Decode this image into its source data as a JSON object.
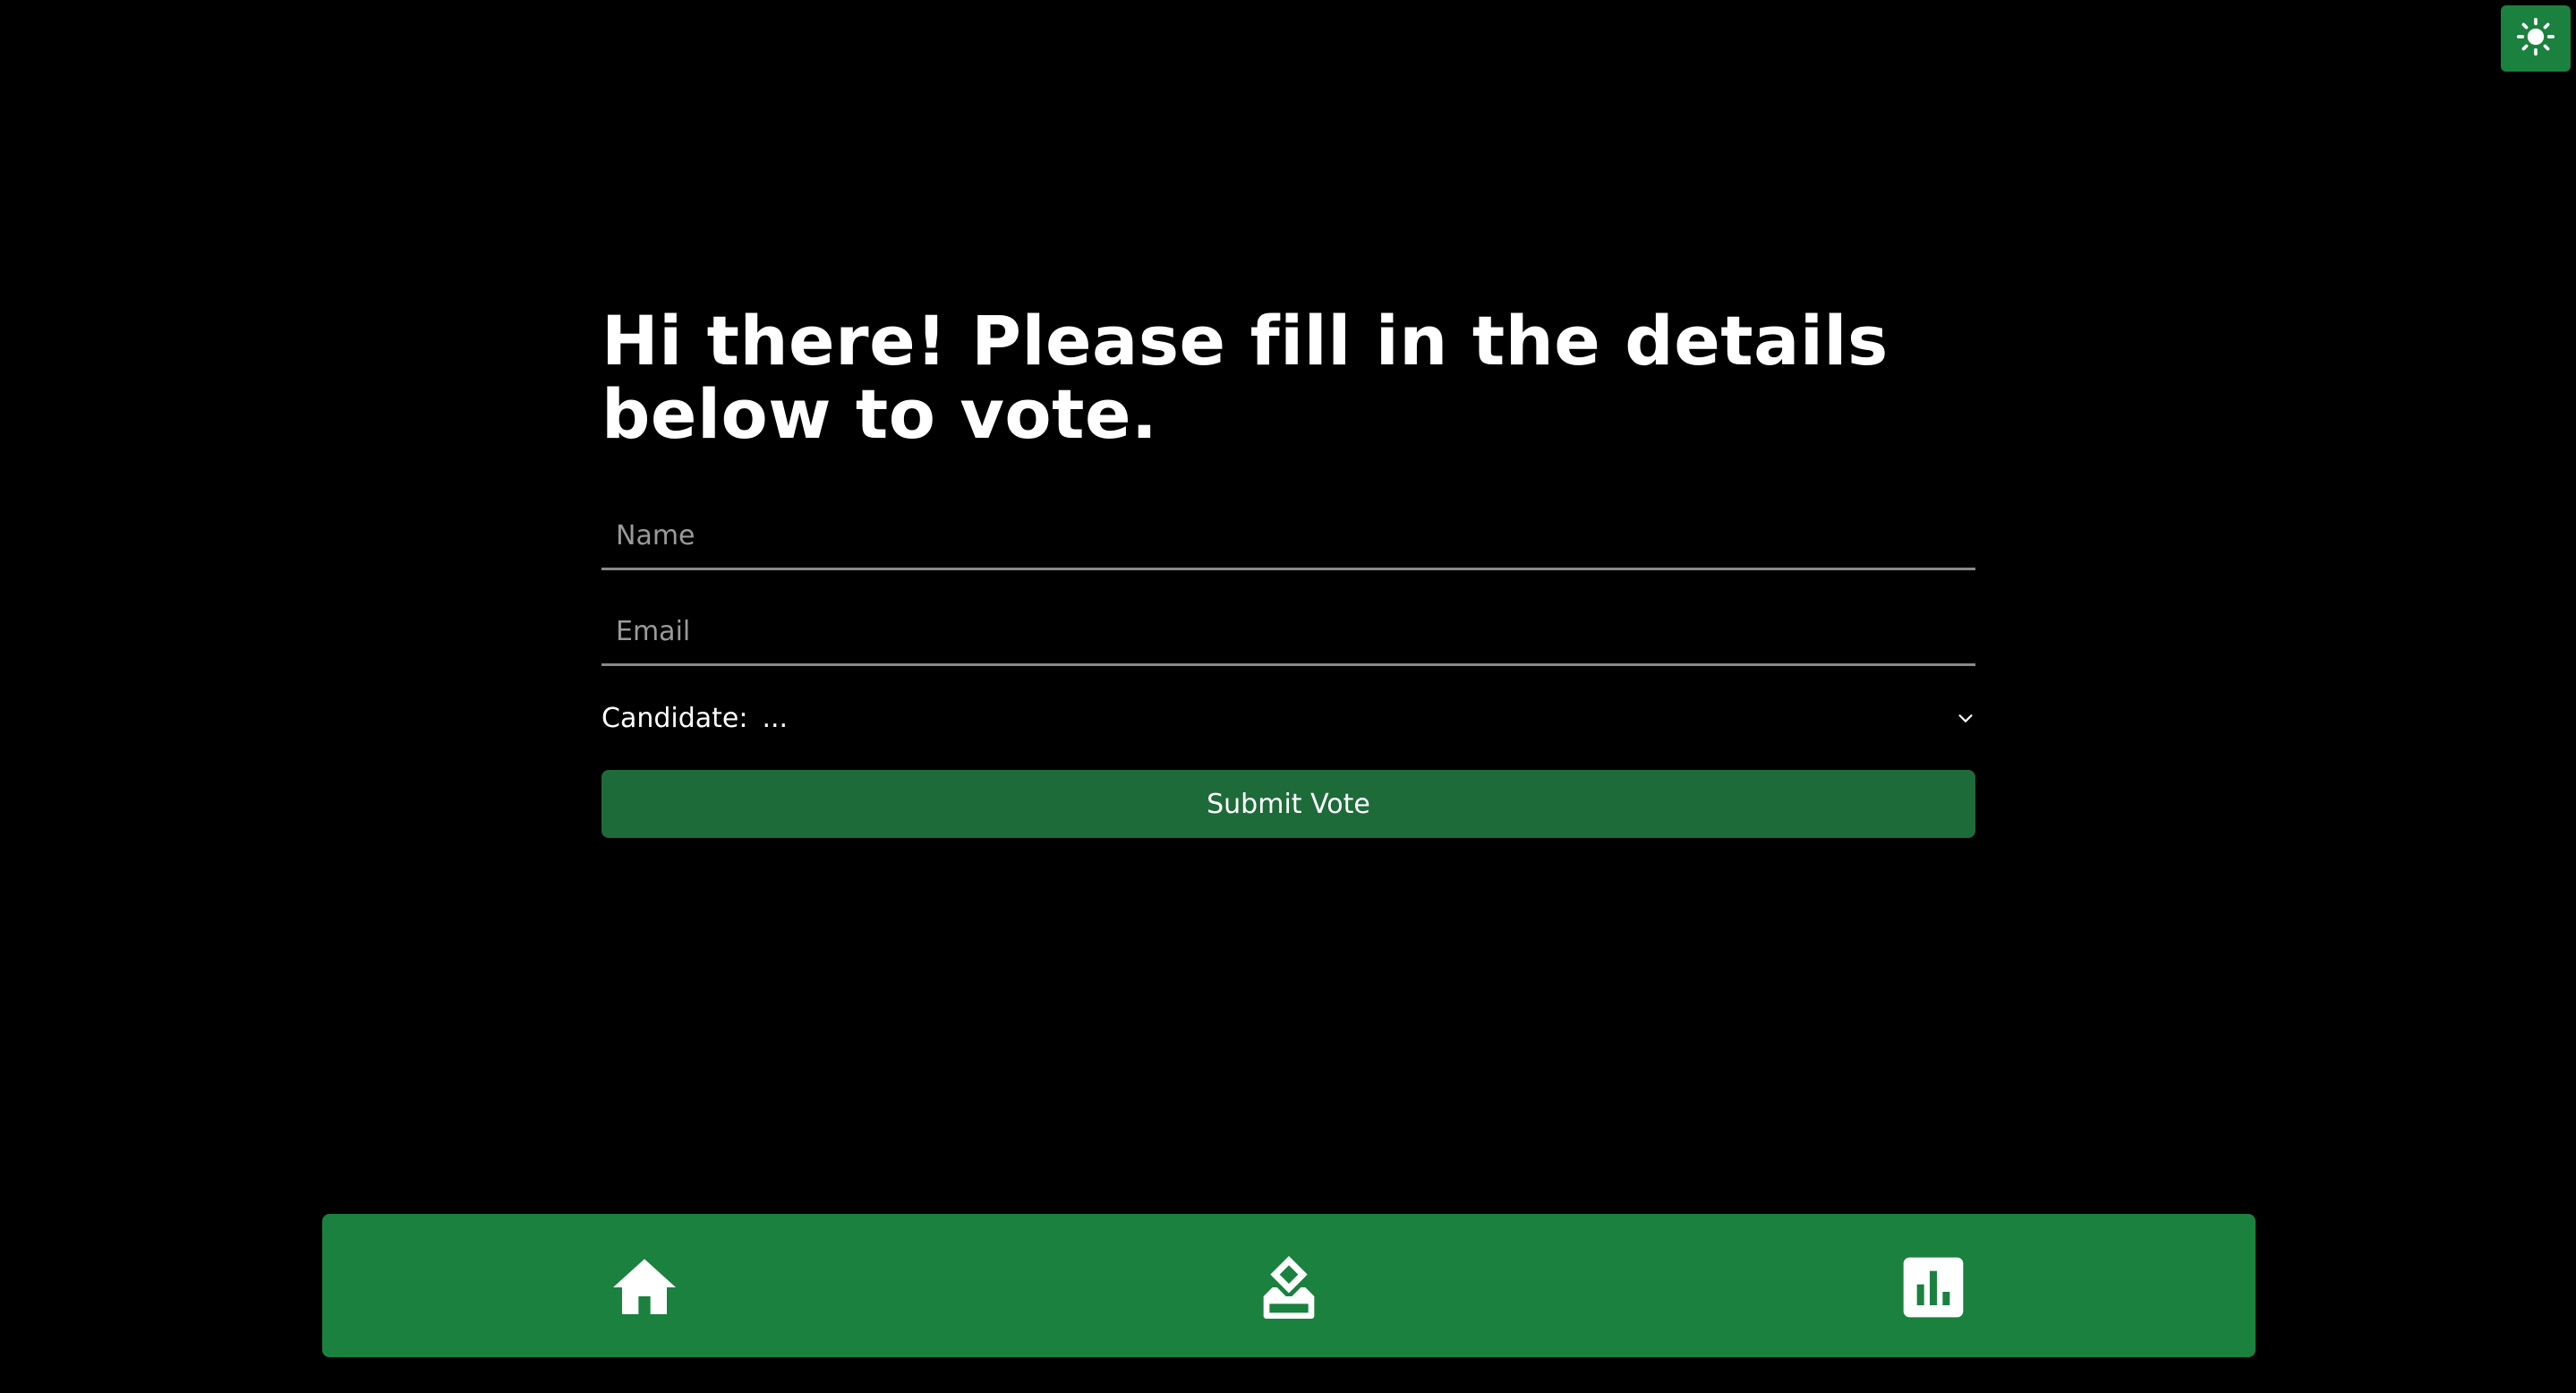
{
  "theme_toggle": {
    "icon": "sun-icon"
  },
  "form": {
    "heading": "Hi there! Please fill in the details below to vote.",
    "name_placeholder": "Name",
    "name_value": "",
    "email_placeholder": "Email",
    "email_value": "",
    "candidate_label": "Candidate:",
    "candidate_selected": "...",
    "submit_label": "Submit Vote"
  },
  "bottom_nav": {
    "items": [
      {
        "name": "home",
        "icon": "home-icon"
      },
      {
        "name": "vote",
        "icon": "ballot-box-icon"
      },
      {
        "name": "results",
        "icon": "bar-chart-icon"
      }
    ]
  },
  "colors": {
    "background": "#000000",
    "accent": "#1b813e",
    "submit_button": "#1e6b3a",
    "text": "#ffffff",
    "placeholder": "#9a9a9a"
  }
}
